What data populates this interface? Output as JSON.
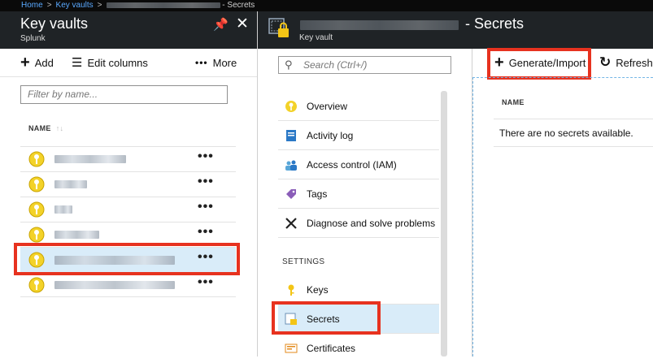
{
  "breadcrumb": {
    "home": "Home",
    "key_vaults": "Key vaults",
    "current": "- Secrets"
  },
  "blade1": {
    "title": "Key vaults",
    "subtitle": "Splunk",
    "toolbar": {
      "add": "Add",
      "edit_columns": "Edit columns",
      "more": "More"
    },
    "filter_placeholder": "Filter by name...",
    "column_header": "NAME",
    "rows": [
      {
        "name": "",
        "more": "•••",
        "selected": false
      },
      {
        "name": "",
        "more": "•••",
        "selected": false
      },
      {
        "name": "",
        "more": "•••",
        "selected": false
      },
      {
        "name": "",
        "more": "•••",
        "selected": false
      },
      {
        "name": "",
        "more": "•••",
        "selected": true
      },
      {
        "name": "",
        "more": "•••",
        "selected": false
      }
    ]
  },
  "blade2": {
    "title": "- Secrets",
    "subtitle": "Key vault",
    "search_placeholder": "Search (Ctrl+/)",
    "menu": [
      {
        "label": "Overview",
        "icon": "key-icon"
      },
      {
        "label": "Activity log",
        "icon": "activity-log-icon"
      },
      {
        "label": "Access control (IAM)",
        "icon": "users-icon"
      },
      {
        "label": "Tags",
        "icon": "tag-icon"
      },
      {
        "label": "Diagnose and solve problems",
        "icon": "wrench-icon"
      }
    ],
    "settings_label": "SETTINGS",
    "settings": [
      {
        "label": "Keys",
        "icon": "key-icon"
      },
      {
        "label": "Secrets",
        "icon": "secret-icon",
        "selected": true
      },
      {
        "label": "Certificates",
        "icon": "certificate-icon"
      }
    ]
  },
  "blade3": {
    "toolbar": {
      "generate": "Generate/Import",
      "refresh": "Refresh"
    },
    "column_header": "NAME",
    "empty_message": "There are no secrets available."
  },
  "colors": {
    "header_bg": "#1f2326",
    "accent_red": "#e7321f",
    "selection": "#d9ecf9",
    "link": "#5aa9ff"
  }
}
